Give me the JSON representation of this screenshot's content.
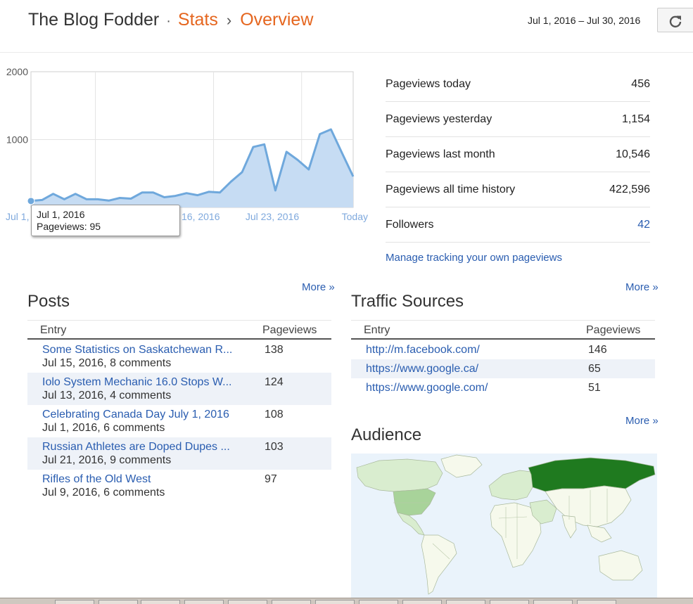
{
  "header": {
    "blog_name": "The Blog Fodder",
    "separator": "·",
    "crumb_stats": "Stats",
    "crumb_chevron": "›",
    "crumb_overview": "Overview",
    "date_range": "Jul 1, 2016 – Jul 30, 2016",
    "refresh_icon": "refresh-icon"
  },
  "chart_data": {
    "type": "area",
    "y_ticks": [
      "2000",
      "1000"
    ],
    "x_tick_labels": [
      "Jul 1,",
      "16, 2016",
      "Jul 23, 2016",
      "Today"
    ],
    "ylim": [
      0,
      2000
    ],
    "grid": true,
    "color": "#6fa8dc",
    "fill": "#c6dcf3",
    "x": [
      "Jul 1",
      "Jul 2",
      "Jul 3",
      "Jul 4",
      "Jul 5",
      "Jul 6",
      "Jul 7",
      "Jul 8",
      "Jul 9",
      "Jul 10",
      "Jul 11",
      "Jul 12",
      "Jul 13",
      "Jul 14",
      "Jul 15",
      "Jul 16",
      "Jul 17",
      "Jul 18",
      "Jul 19",
      "Jul 20",
      "Jul 21",
      "Jul 22",
      "Jul 23",
      "Jul 24",
      "Jul 25",
      "Jul 26",
      "Jul 27",
      "Jul 28",
      "Jul 29",
      "Jul 30"
    ],
    "values": [
      95,
      110,
      200,
      120,
      200,
      120,
      120,
      100,
      140,
      130,
      220,
      220,
      150,
      170,
      210,
      180,
      230,
      220,
      380,
      520,
      890,
      930,
      250,
      820,
      700,
      560,
      1080,
      1150,
      800,
      456
    ],
    "tooltip": {
      "date": "Jul 1, 2016",
      "label": "Pageviews: 95"
    }
  },
  "stats": [
    {
      "label": "Pageviews today",
      "value": "456",
      "link": false
    },
    {
      "label": "Pageviews yesterday",
      "value": "1,154",
      "link": false
    },
    {
      "label": "Pageviews last month",
      "value": "10,546",
      "link": false
    },
    {
      "label": "Pageviews all time history",
      "value": "422,596",
      "link": false
    },
    {
      "label": "Followers",
      "value": "42",
      "link": true
    }
  ],
  "manage_link": "Manage tracking your own pageviews",
  "posts": {
    "more": "More »",
    "title": "Posts",
    "col_entry": "Entry",
    "col_views": "Pageviews",
    "rows": [
      {
        "title": "Some Statistics on Saskatchewan R...",
        "meta": "Jul 15, 2016, 8 comments",
        "views": "138"
      },
      {
        "title": "Iolo System Mechanic 16.0 Stops W...",
        "meta": "Jul 13, 2016, 4 comments",
        "views": "124"
      },
      {
        "title": "Celebrating Canada Day July 1, 2016",
        "meta": "Jul 1, 2016, 6 comments",
        "views": "108"
      },
      {
        "title": "Russian Athletes are Doped Dupes ...",
        "meta": "Jul 21, 2016, 9 comments",
        "views": "103"
      },
      {
        "title": "Rifles of the Old West",
        "meta": "Jul 9, 2016, 6 comments",
        "views": "97"
      }
    ]
  },
  "traffic": {
    "more": "More »",
    "title": "Traffic Sources",
    "col_entry": "Entry",
    "col_views": "Pageviews",
    "rows": [
      {
        "url": "http://m.facebook.com/",
        "views": "146"
      },
      {
        "url": "https://www.google.ca/",
        "views": "65"
      },
      {
        "url": "https://www.google.com/",
        "views": "51"
      }
    ]
  },
  "audience": {
    "more": "More »",
    "title": "Audience",
    "colors": {
      "ocean": "#eaf3fb",
      "none": "#f6f9ec",
      "low": "#d9edcf",
      "mid": "#a8d39a",
      "high": "#1f7a1f"
    }
  }
}
